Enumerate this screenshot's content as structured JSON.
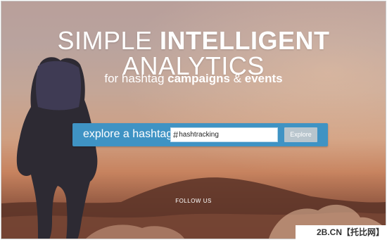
{
  "hero": {
    "headline_prefix": "SIMPLE",
    "headline_bold": "INTELLIGENT",
    "headline_suffix": "ANALYTICS",
    "sub_prefix": "for hashtag",
    "sub_bold1": "campaigns",
    "sub_mid": "&",
    "sub_bold2": "events"
  },
  "search": {
    "label": "explore a hashtag",
    "hash_symbol": "#",
    "value": "hashtracking",
    "button_label": "Explore"
  },
  "footer": {
    "follow_label": "FOLLOW US"
  },
  "watermark": {
    "text": "2B.CN【托比网】"
  },
  "colors": {
    "search_bar": "#3f93c4",
    "button": "#b8c5cd",
    "text": "#ffffff"
  },
  "icons": {
    "hash": "hash-icon"
  }
}
